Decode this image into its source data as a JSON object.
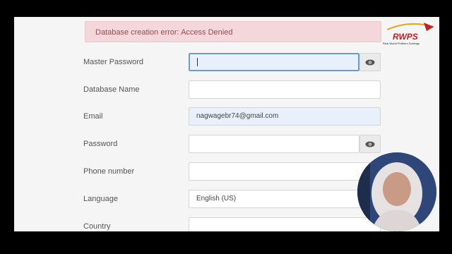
{
  "alert": {
    "text": "Database creation error: Access Denied"
  },
  "form": {
    "master_password_label": "Master Password",
    "database_name_label": "Database Name",
    "email_label": "Email",
    "email_value": "nagwagebr74@gmail.com",
    "password_label": "Password",
    "phone_label": "Phone number",
    "language_label": "Language",
    "language_value": "English (US)",
    "country_label": "Country"
  },
  "overlay": {
    "logo_text": "RWPS",
    "logo_subtext": "Real World Problem Solvings"
  },
  "colors": {
    "alert_bg": "#f3d7da",
    "alert_text": "#9a4a52",
    "focus_border": "#6f9fc9",
    "logo_red": "#c0202a"
  },
  "icons": {
    "password_toggle": "eye-icon"
  }
}
